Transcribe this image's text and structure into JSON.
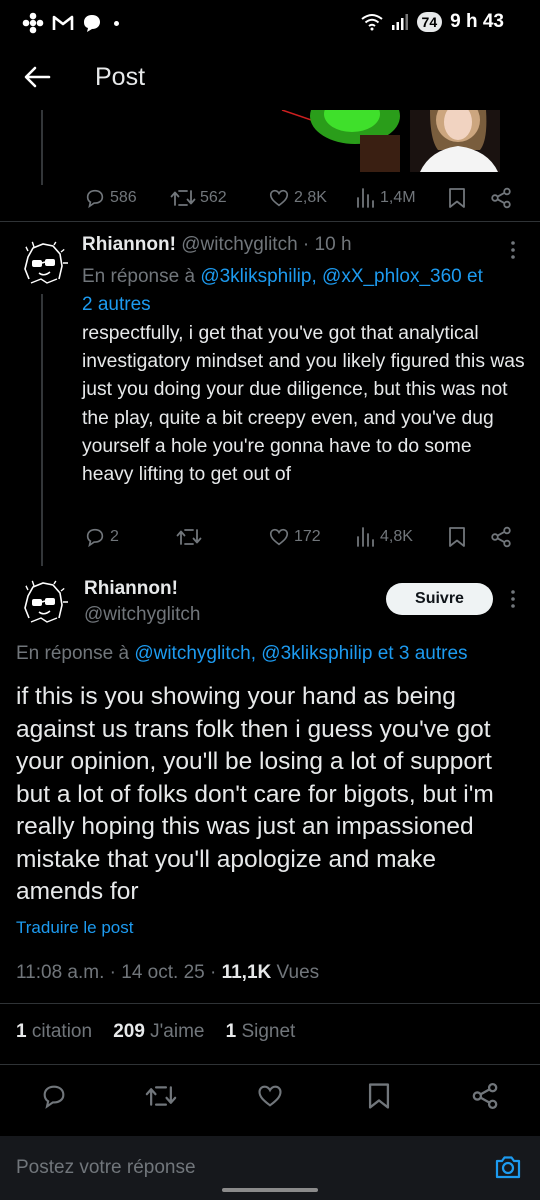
{
  "status_bar": {
    "time": "9 h 43",
    "battery": "74"
  },
  "header": {
    "title": "Post"
  },
  "parent_post": {
    "actions": {
      "replies": "586",
      "reposts": "562",
      "likes": "2,8K",
      "views": "1,4M"
    }
  },
  "reply": {
    "name": "Rhiannon!",
    "handle_time": "@witchyglitch · 10 h",
    "in_reply_prefix": "En réponse à ",
    "in_reply_users": "@3kliksphilip, @xX_phlox_360",
    "in_reply_and": " et",
    "in_reply_more": "2 autres",
    "text": "respectfully, i get that you've got that analytical investigatory mindset and you likely figured this was just you doing your due diligence, but this was not the play, quite a bit creepy even, and you've dug yourself a hole you're gonna have to do some heavy lifting to get out of",
    "actions": {
      "replies": "2",
      "reposts": "",
      "likes": "172",
      "views": "4,8K"
    }
  },
  "main_post": {
    "name": "Rhiannon!",
    "handle": "@witchyglitch",
    "follow_label": "Suivre",
    "in_reply_prefix": "En réponse à ",
    "in_reply_links": "@witchyglitch, @3kliksphilip et 3 autres",
    "text": "if this is you showing your hand as being against us trans folk then i guess you've got your opinion, you'll be losing a lot of support but a lot of folks don't care for bigots, but i'm really hoping this was just an impassioned mistake that you'll apologize and make amends for",
    "translate_label": "Traduire le post",
    "time": "11:08 a.m. · 14 oct. 25 · ",
    "views_count": "11,1K",
    "views_label": " Vues",
    "stats": {
      "quotes_count": "1",
      "quotes_label": " citation",
      "likes_count": "209",
      "likes_label": " J'aime",
      "bookmarks_count": "1",
      "bookmarks_label": " Signet"
    }
  },
  "compose": {
    "placeholder": "Postez votre réponse"
  },
  "colors": {
    "background": "#000000",
    "accent": "#1d9bf0",
    "muted": "#71767b",
    "text": "#e7e9ea"
  },
  "icons": [
    "back-arrow-icon",
    "reply-icon",
    "repost-icon",
    "like-icon",
    "views-icon",
    "bookmark-icon",
    "share-icon",
    "more-icon",
    "camera-icon",
    "wifi-icon",
    "signal-icon"
  ]
}
